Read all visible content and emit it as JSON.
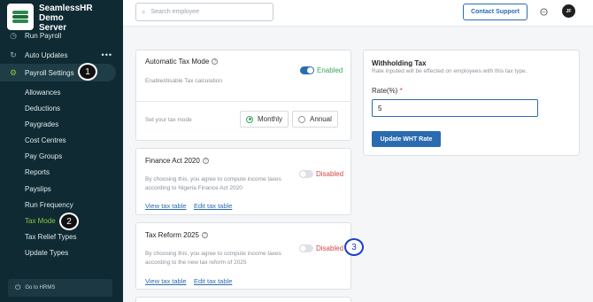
{
  "brand": {
    "line1": "SeamlessHR",
    "line2": "Demo",
    "line3": "Server"
  },
  "sidebar": {
    "run_payroll_partial": "Run Payroll",
    "auto_updates": "Auto Updates",
    "payroll_settings": "Payroll Settings",
    "sub_items": [
      "Allowances",
      "Deductions",
      "Paygrades",
      "Cost Centres",
      "Pay Groups",
      "Reports",
      "Payslips",
      "Run Frequency",
      "Tax Mode",
      "Tax Relief Types",
      "Update Types"
    ],
    "goto_hrms": "Go to HRMS",
    "step1": "1",
    "step2": "2"
  },
  "topbar": {
    "search_placeholder": "Search employee",
    "support_label": "Contact Support",
    "avatar_initials": "JF"
  },
  "auto_tax": {
    "title": "Automatic Tax Mode",
    "state": "Enabled",
    "desc": "Enable/disable Tax calculation",
    "mode_label": "Set your tax mode",
    "monthly": "Monthly",
    "annual": "Annual"
  },
  "finance_act": {
    "title": "Finance Act 2020",
    "state": "Disabled",
    "desc1": "By choosing this, you agree to compute income taxes",
    "desc2": "according to Nigeria Finance Act 2020",
    "view_link": "View tax table",
    "edit_link": "Edit tax table"
  },
  "tax_reform": {
    "title": "Tax Reform 2025",
    "state": "Disabled",
    "desc1": "By choosing this, you agree to compute income taxes",
    "desc2": "according to the new tax reform of 2025",
    "view_link": "View tax table",
    "edit_link": "Edit tax table",
    "step3": "3"
  },
  "wht": {
    "title": "Withholding Tax",
    "subtitle": "Rate inputed will be effected on employees with this tax type.",
    "rate_label": "Rate(%)",
    "required_mark": "*",
    "rate_value": "5",
    "button": "Update WHT Rate"
  }
}
